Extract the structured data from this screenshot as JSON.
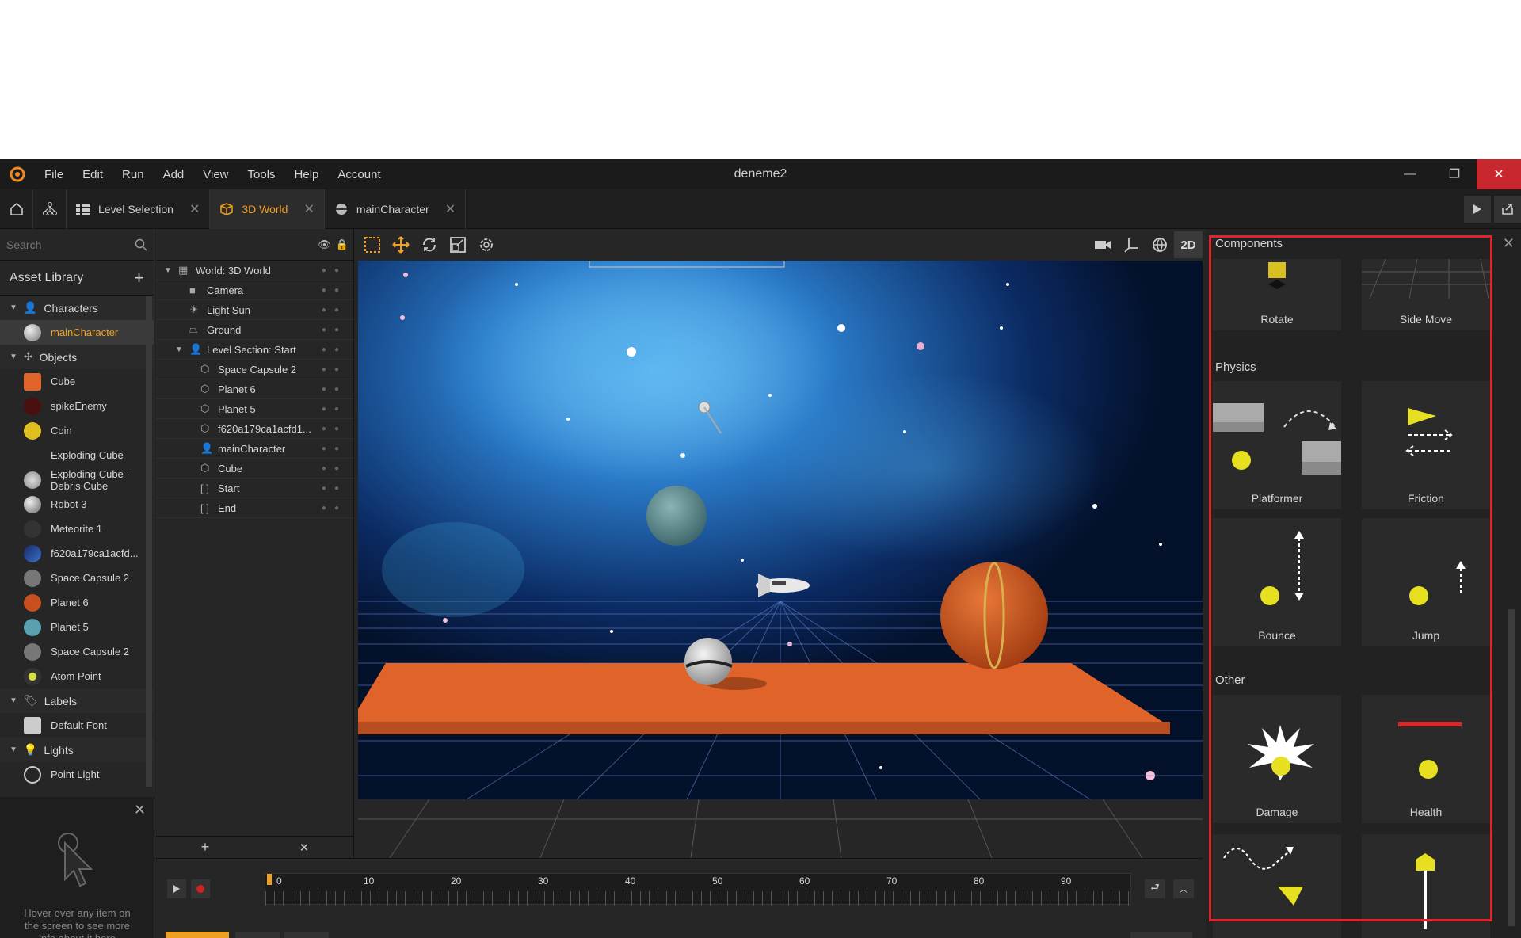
{
  "app_title": "deneme2",
  "menu": [
    "File",
    "Edit",
    "Run",
    "Add",
    "View",
    "Tools",
    "Help",
    "Account"
  ],
  "tabs": [
    {
      "label": "Level Selection"
    },
    {
      "label": "3D World"
    },
    {
      "label": "mainCharacter"
    }
  ],
  "search": {
    "placeholder": "Search"
  },
  "asset_library": {
    "title": "Asset Library",
    "categories": [
      {
        "label": "Characters",
        "items": [
          {
            "label": "mainCharacter"
          }
        ]
      },
      {
        "label": "Objects",
        "items": [
          {
            "label": "Cube"
          },
          {
            "label": "spikeEnemy"
          },
          {
            "label": "Coin"
          },
          {
            "label": "Exploding Cube"
          },
          {
            "label": "Exploding Cube - Debris Cube"
          },
          {
            "label": "Robot 3"
          },
          {
            "label": "Meteorite 1"
          },
          {
            "label": "f620a179ca1acfd..."
          },
          {
            "label": "Space Capsule 2"
          },
          {
            "label": "Planet 6"
          },
          {
            "label": "Planet 5"
          },
          {
            "label": "Space Capsule 2"
          },
          {
            "label": "Atom Point"
          }
        ]
      },
      {
        "label": "Labels",
        "items": [
          {
            "label": "Default Font"
          }
        ]
      },
      {
        "label": "Lights",
        "items": [
          {
            "label": "Point Light"
          }
        ]
      }
    ]
  },
  "help_text": "Hover over any item on the screen to see more info about it here",
  "hierarchy": [
    {
      "label": "World: 3D World"
    },
    {
      "label": "Camera"
    },
    {
      "label": "Light Sun"
    },
    {
      "label": "Ground"
    },
    {
      "label": "Level Section: Start"
    },
    {
      "label": "Space Capsule 2"
    },
    {
      "label": "Planet 6"
    },
    {
      "label": "Planet 5"
    },
    {
      "label": "f620a179ca1acfd1..."
    },
    {
      "label": "mainCharacter"
    },
    {
      "label": "Cube"
    },
    {
      "label": "Start"
    },
    {
      "label": "End"
    }
  ],
  "viewport_mode": "2D",
  "timeline_ticks": [
    "0",
    "10",
    "20",
    "30",
    "40",
    "50",
    "60",
    "70",
    "80",
    "90"
  ],
  "components": {
    "title": "Components",
    "top": [
      "Rotate",
      "Side Move"
    ],
    "physics_title": "Physics",
    "physics": [
      "Platformer",
      "Friction",
      "Bounce",
      "Jump"
    ],
    "other_title": "Other",
    "other": [
      "Damage",
      "Health"
    ]
  },
  "colors": {
    "accent": "#f0a020",
    "highlight": "#e0242b",
    "ground": "#e0642a"
  }
}
